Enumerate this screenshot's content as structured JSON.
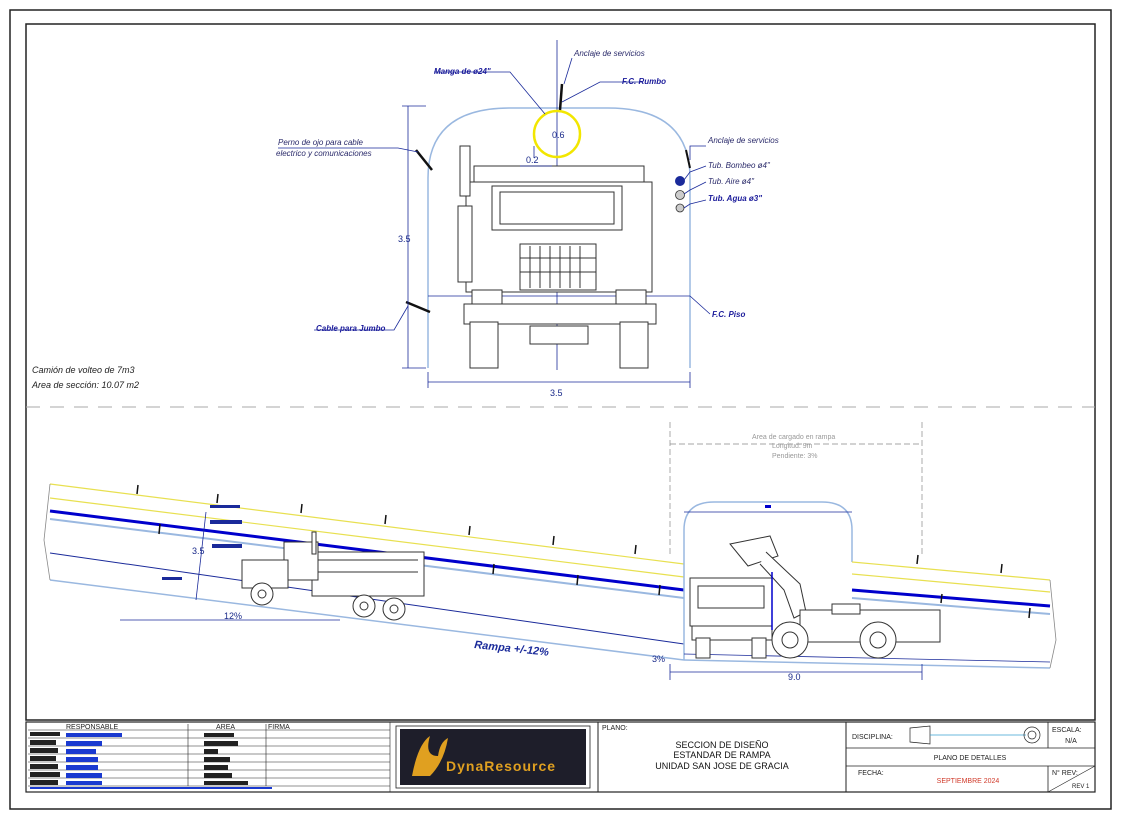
{
  "section_view": {
    "labels": {
      "manga": "Manga de ø24\"",
      "anclaje_top": "Anclaje de servicios",
      "fc_rumbo": "F.C. Rumbo",
      "perno_line1": "Perno de ojo para cable",
      "perno_line2": "electrico y comunicaciones",
      "anclaje_right": "Anclaje de servicios",
      "tub_bombeo": "Tub. Bombeo ø4\"",
      "tub_aire": "Tub. Aire ø4\"",
      "tub_agua": "Tub. Agua ø3\"",
      "fc_piso": "F.C. Piso",
      "cable_jumbo": "Cable para Jumbo"
    },
    "dims": {
      "height": "3.5",
      "width": "3.5",
      "vent_dia": "0.6",
      "vent_offset": "0.2"
    },
    "notes": {
      "truck": "Camión de volteo de 7m3",
      "area": "Area de sección: 10.07 m2"
    }
  },
  "profile_view": {
    "loading_area": {
      "title": "Area de cargado en rampa",
      "length": "Longitud: 9m",
      "slope": "Pendiente: 3%"
    },
    "dims": {
      "height": "3.5",
      "slope_pct": "12%",
      "bay_len": "9.0",
      "bay_slope": "3%"
    },
    "ramp_label": "Rampa +/-12%"
  },
  "title_block": {
    "headers": {
      "responsable": "RESPONSABLE",
      "area": "AREA",
      "firma": "FIRMA"
    },
    "logo_text": "DynaResource",
    "plano_label": "PLANO:",
    "plano_line1": "SECCION DE DISEÑO",
    "plano_line2": "ESTANDAR DE RAMPA",
    "plano_line3": "UNIDAD SAN JOSE DE GRACIA",
    "disciplina_label": "DISCIPLINA:",
    "escala_label": "ESCALA:",
    "escala_value": "N/A",
    "sheet_title": "PLANO DE DETALLES",
    "fecha_label": "FECHA:",
    "fecha_value": "SEPTIEMBRE 2024",
    "rev_label": "N° REV:",
    "rev_value": "REV 1"
  },
  "colors": {
    "blue_dim": "#1a2a9a",
    "tunnel": "#9ab8e0",
    "vent": "#f2e600",
    "yellow_line": "#e8e050",
    "deep_blue": "#0000cc",
    "date_red": "#d03a2a",
    "logo_gold": "#e0a020",
    "logo_bg": "#1e1e2a"
  }
}
